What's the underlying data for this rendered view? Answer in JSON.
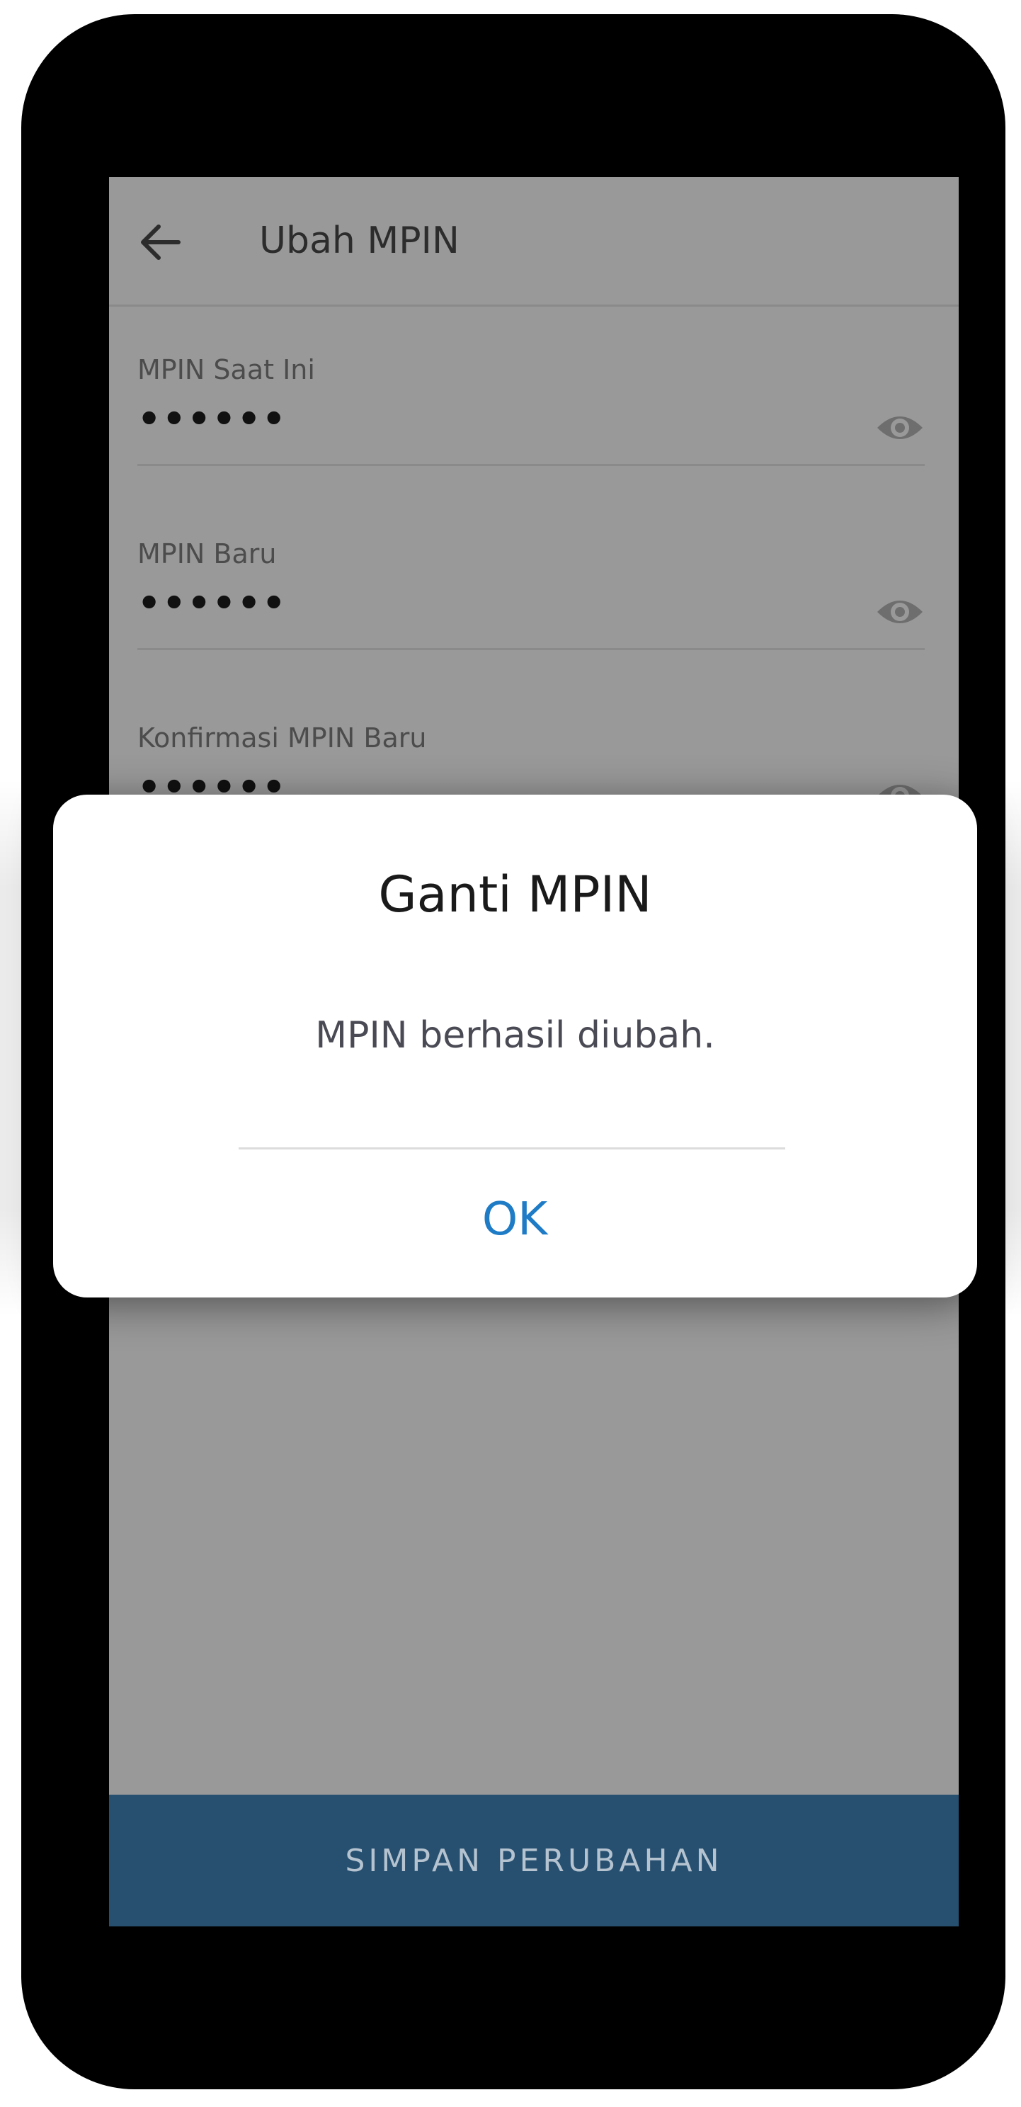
{
  "header": {
    "title": "Ubah MPIN",
    "back_icon": "arrow-left-icon"
  },
  "form": {
    "fields": [
      {
        "label": "MPIN Saat Ini",
        "value": "••••••",
        "icon": "eye-icon"
      },
      {
        "label": "MPIN Baru",
        "value": "••••••",
        "icon": "eye-icon"
      },
      {
        "label": "Konfirmasi MPIN Baru",
        "value": "••••••",
        "icon": "eye-icon"
      }
    ]
  },
  "footer": {
    "save_label": "SIMPAN PERUBAHAN"
  },
  "dialog": {
    "title": "Ganti MPIN",
    "message": "MPIN berhasil diubah.",
    "ok_label": "OK"
  },
  "colors": {
    "overlay": "#999999",
    "save_bar": "#275070",
    "ok_text": "#1e7bc6"
  }
}
